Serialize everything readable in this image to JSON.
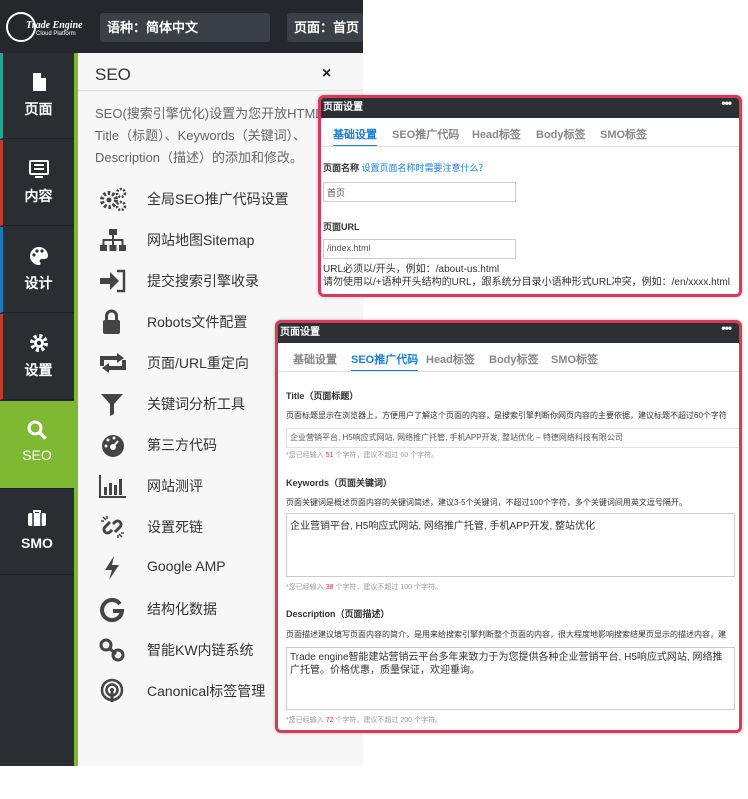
{
  "topbar": {
    "logo": {
      "text": "Trade Engine",
      "sub": "Cloud Platform"
    },
    "language": "语种：简体中文",
    "page": "页面：首页"
  },
  "leftnav": {
    "items": [
      {
        "label": "页面",
        "icon": "page-icon"
      },
      {
        "label": "内容",
        "icon": "content-icon"
      },
      {
        "label": "设计",
        "icon": "palette-icon"
      },
      {
        "label": "设置",
        "icon": "gear-icon"
      },
      {
        "label": "SEO",
        "icon": "search-icon"
      },
      {
        "label": "SMO",
        "icon": "briefcase-icon"
      }
    ],
    "active": "SEO",
    "active_color": "#7fb934"
  },
  "seo_panel": {
    "title": "SEO",
    "close": "×",
    "desc": "SEO(搜索引擎优化)设置为您开放HTML代码中Title（标题）、Keywords（关键词）、Description（描述）的添加和修改。",
    "menu": [
      {
        "label": "全局SEO推广代码设置",
        "icon": "gears-icon"
      },
      {
        "label": "网站地图Sitemap",
        "icon": "sitemap-icon"
      },
      {
        "label": "提交搜索引擎收录",
        "icon": "submit-icon"
      },
      {
        "label": "Robots文件配置",
        "icon": "lock-icon"
      },
      {
        "label": "页面/URL重定向",
        "icon": "redirect-icon"
      },
      {
        "label": "关键词分析工具",
        "icon": "filter-icon"
      },
      {
        "label": "第三方代码",
        "icon": "dashboard-icon"
      },
      {
        "label": "网站测评",
        "icon": "bar-chart-icon"
      },
      {
        "label": "设置死链",
        "icon": "broken-link-icon"
      },
      {
        "label": "Google AMP",
        "icon": "bolt-icon"
      },
      {
        "label": "结构化数据",
        "icon": "google-icon"
      },
      {
        "label": "智能KW内链系统",
        "icon": "link-icon"
      },
      {
        "label": "Canonical标签管理",
        "icon": "podcast-icon"
      }
    ]
  },
  "dialog1": {
    "title": "页面设置",
    "dots": "•••",
    "tabs": [
      "基础设置",
      "SEO推广代码",
      "Head标签",
      "Body标签",
      "SMO标签"
    ],
    "active_tab": 0,
    "page_name_label": "页面名称",
    "page_name_link": "设置页面名称时需要注意什么？",
    "page_name_value": "首页",
    "url_label": "页面URL",
    "url_value": "/index.html",
    "url_note1": "URL必须以/开头，例如：/about-us.html",
    "url_note2": "请勿使用以/+语种开头结构的URL，跟系统分目录小语种形式URL冲突，例如：/en/xxxx.html"
  },
  "dialog2": {
    "title": "页面设置",
    "dots": "•••",
    "tabs": [
      "基础设置",
      "SEO推广代码",
      "Head标签",
      "Body标签",
      "SMO标签"
    ],
    "active_tab": 1,
    "title_label": "Title（页面标题）",
    "title_desc": "页面标题显示在浏览器上，方便用户了解这个页面的内容，是搜索引擎判断你网页内容的主要依据，建议标题不超过60个字符",
    "title_value": "企业营销平台, H5响应式网站, 网络推广托管, 手机APP开发, 整站优化 – 特德网络科技有限公司",
    "title_hint_pre": "*您已经输入",
    "title_count": "51",
    "title_hint_post": "个字符，建议不超过 60 个字符。",
    "kw_label": "Keywords（页面关键词）",
    "kw_desc": "页面关键词是概述页面内容的关键词简述，建议3-5个关键词，不超过100个字符，多个关键词间用英文逗号隔开。",
    "kw_value": "企业营销平台, H5响应式网站, 网络推广托管, 手机APP开发, 整站优化",
    "kw_hint_pre": "*您已经输入",
    "kw_count": "38",
    "kw_hint_post": "个字符，建议不超过 100 个字符。",
    "desc_label": "Description（页面描述）",
    "desc_desc": "页面描述建议填写页面内容的简介，是用来给搜索引擎判断整个页面的内容，很大程度地影响搜索结果页显示的描述内容，建",
    "desc_value": "Trade engine智能建站营销云平台多年来致力于为您提供各种企业营销平台, H5响应式网站, 网络推广托管。价格优惠，质量保证，欢迎垂询。",
    "desc_hint_pre": "*您已经输入",
    "desc_count": "72",
    "desc_hint_post": "个字符，建议不超过 200 个字符。"
  },
  "colors": {
    "accent": "#7fb934",
    "dialog_border": "#d83a5c",
    "tab_active": "#1a7fd5"
  }
}
